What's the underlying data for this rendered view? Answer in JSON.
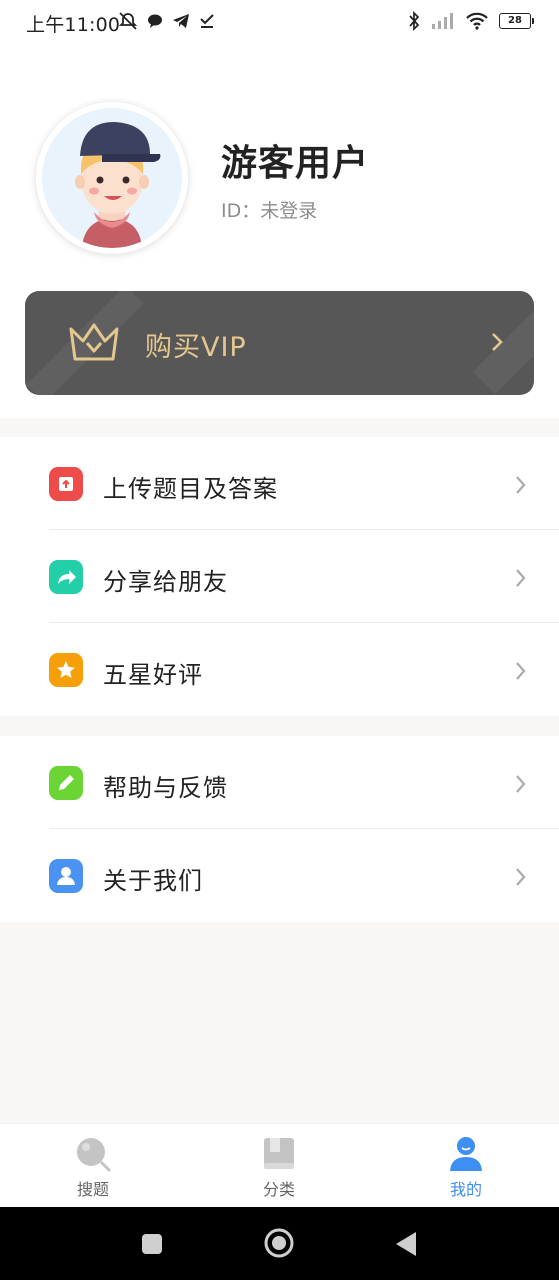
{
  "status_bar": {
    "time": "上午11:00",
    "battery": "28"
  },
  "profile": {
    "username": "游客用户",
    "user_id": "ID：未登录"
  },
  "vip": {
    "label": "购买VIP",
    "text_color": "#e4c78f",
    "card_color": "#575757"
  },
  "menu": {
    "group1": [
      {
        "label": "上传题目及答案",
        "icon": "upload-icon",
        "color": "#ee4b4b"
      },
      {
        "label": "分享给朋友",
        "icon": "share-icon",
        "color": "#22cfa9"
      },
      {
        "label": "五星好评",
        "icon": "star-icon",
        "color": "#f5a008"
      }
    ],
    "group2": [
      {
        "label": "帮助与反馈",
        "icon": "pencil-icon",
        "color": "#6ad534"
      },
      {
        "label": "关于我们",
        "icon": "person-icon",
        "color": "#4a93f3"
      }
    ]
  },
  "tabs": [
    {
      "label": "搜题",
      "icon": "search-icon",
      "active": false
    },
    {
      "label": "分类",
      "icon": "book-icon",
      "active": false
    },
    {
      "label": "我的",
      "icon": "profile-icon",
      "active": true
    }
  ],
  "colors": {
    "accent": "#3d8ff3",
    "inactive_tab": "#c4c4c4"
  }
}
